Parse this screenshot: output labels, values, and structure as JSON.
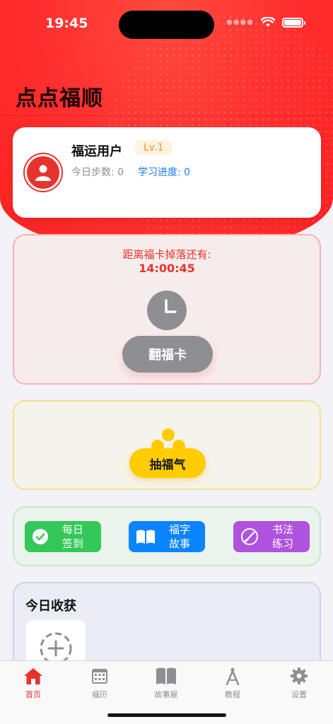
{
  "status_bar": {
    "time": "19:45"
  },
  "app": {
    "title": "点点福顺"
  },
  "user": {
    "name": "福运用户",
    "level": "Lv.1",
    "steps": "今日步数: 0",
    "progress": "学习进度: 0"
  },
  "fuka": {
    "countdown_label": "距离福卡掉落还有:",
    "countdown_time": "14:00:45",
    "flip_label": "翻福卡"
  },
  "luck": {
    "draw_label": "抽福气"
  },
  "actions": [
    {
      "label": "每日\n签到",
      "icon": "check-circle-icon",
      "color": "#34c759"
    },
    {
      "label": "福字\n故事",
      "icon": "book-icon",
      "color": "#0a84ff"
    },
    {
      "label": "书法\n练习",
      "icon": "brush-icon",
      "color": "#af52de"
    }
  ],
  "harvest": {
    "title": "今日收获",
    "add_icon": "add-circle-icon"
  },
  "tabs": [
    {
      "label": "首页",
      "icon": "home-icon",
      "active": true
    },
    {
      "label": "福历",
      "icon": "calendar-icon",
      "active": false
    },
    {
      "label": "故事屋",
      "icon": "book-icon",
      "active": false
    },
    {
      "label": "教程",
      "icon": "compass-icon",
      "active": false
    },
    {
      "label": "设置",
      "icon": "gear-icon",
      "active": false
    }
  ],
  "colors": {
    "brand_red": "#e8322d",
    "gold": "#ffcc00",
    "link_blue": "#1e7cf5",
    "inactive_gray": "#8e8e93"
  }
}
